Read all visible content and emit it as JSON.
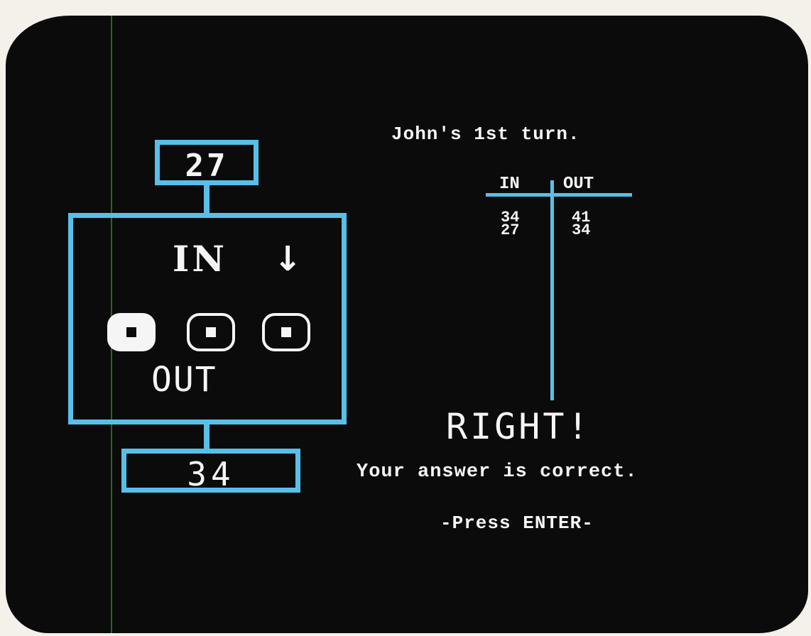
{
  "game": {
    "input_box_value": "27",
    "output_box_value": "34",
    "machine_in_label": "IN",
    "machine_in_arrow": "↓",
    "machine_out_label": "OUT",
    "dials": [
      "filled",
      "empty",
      "empty"
    ]
  },
  "turn": {
    "text": "John's 1st turn."
  },
  "io_table": {
    "headers": [
      "IN",
      "OUT"
    ],
    "in_values": [
      "34",
      "27"
    ],
    "out_values": [
      "41",
      "34"
    ]
  },
  "feedback": {
    "result": "RIGHT!",
    "message": "Your answer is correct.",
    "prompt": "-Press ENTER-"
  },
  "colors": {
    "screen_background": "#0c0b0c",
    "frame_blue": "#58c0e8",
    "text": "#f5f5f5"
  }
}
